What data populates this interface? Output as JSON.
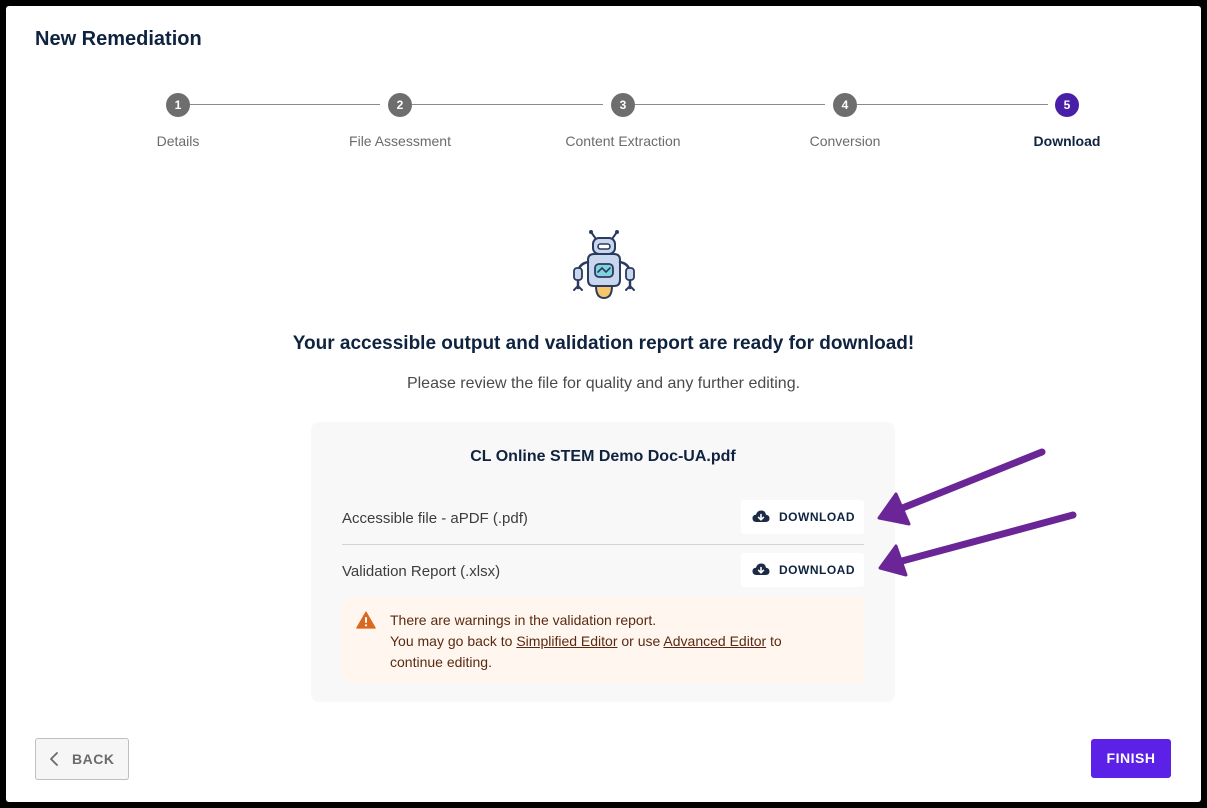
{
  "page": {
    "title": "New Remediation"
  },
  "stepper": {
    "steps": [
      {
        "number": "1",
        "label": "Details"
      },
      {
        "number": "2",
        "label": "File Assessment"
      },
      {
        "number": "3",
        "label": "Content Extraction"
      },
      {
        "number": "4",
        "label": "Conversion"
      },
      {
        "number": "5",
        "label": "Download"
      }
    ],
    "active_step": 5
  },
  "main": {
    "headline": "Your accessible output and validation report are ready for download!",
    "subline": "Please review the file for quality and any further editing.",
    "illustration_icon": "robot-icon"
  },
  "card": {
    "file_name": "CL Online STEM Demo Doc-UA.pdf",
    "rows": [
      {
        "label": "Accessible file - aPDF (.pdf)",
        "button_label": "DOWNLOAD",
        "button_icon": "cloud-download-icon"
      },
      {
        "label": "Validation Report (.xlsx)",
        "button_label": "DOWNLOAD",
        "button_icon": "cloud-download-icon"
      }
    ],
    "warning": {
      "icon": "warning-triangle-icon",
      "line1": "There are warnings in the validation report.",
      "line2_prefix": "You may go back to ",
      "link1": "Simplified Editor",
      "line2_middle": " or use ",
      "link2": "Advanced Editor",
      "line2_suffix": " to",
      "line3": "continue editing."
    }
  },
  "footer": {
    "back_label": "BACK",
    "finish_label": "FINISH"
  },
  "colors": {
    "accent": "#5b21e6",
    "active_step": "#4a1fa8",
    "annotation_arrow": "#6a2696",
    "warning_icon": "#d9691e",
    "title_text": "#0f2340"
  }
}
